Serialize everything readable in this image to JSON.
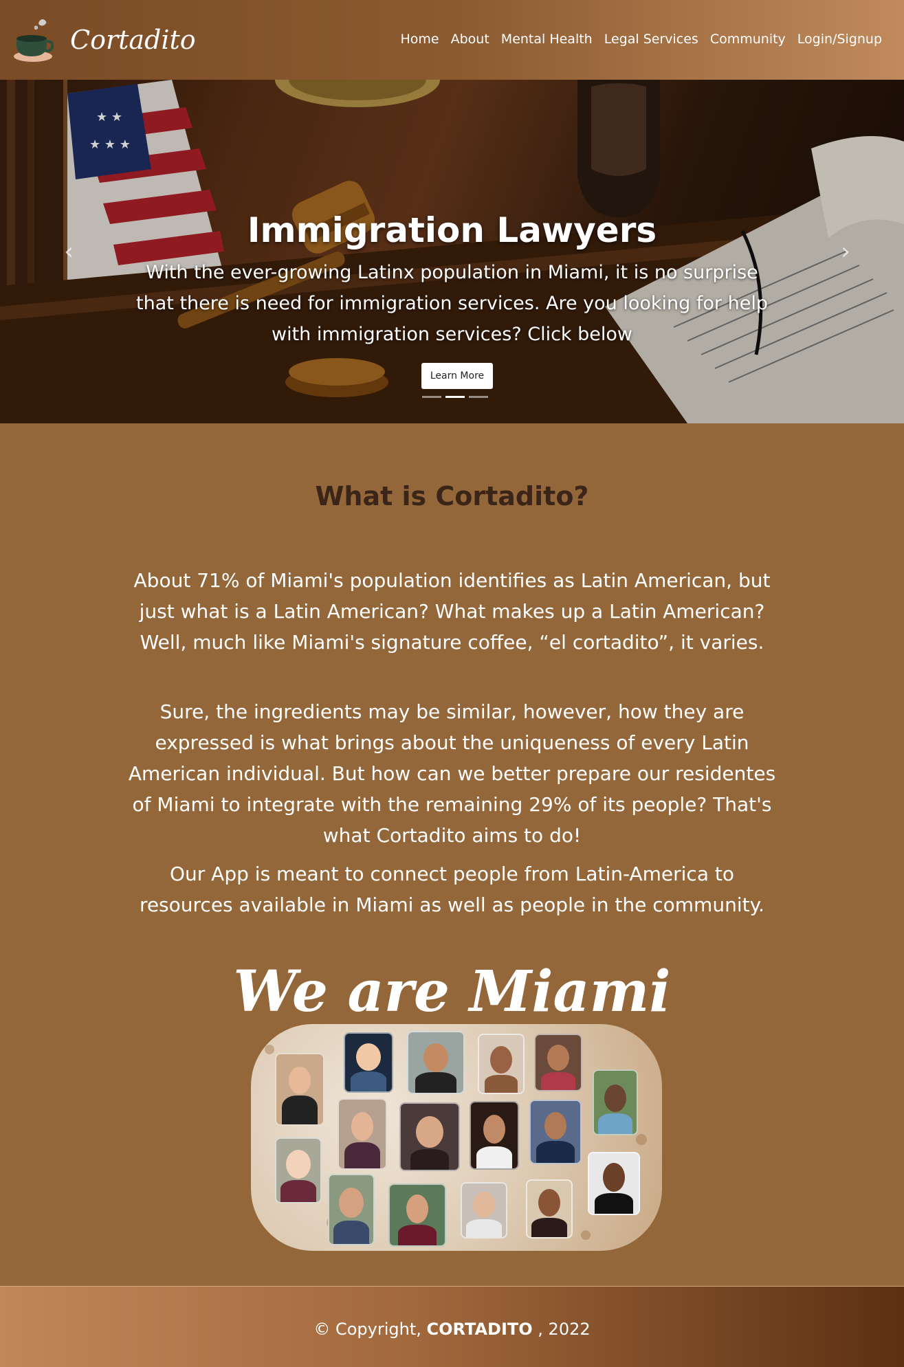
{
  "nav": {
    "brand": "Cortadito",
    "links": [
      "Home",
      "About",
      "Mental Health",
      "Legal Services",
      "Community",
      "Login/Signup"
    ]
  },
  "hero": {
    "title": "Immigration Lawyers",
    "text": "With the ever-growing Latinx population in Miami, it is no surprise that there is need for immigration services. Are you looking for help with immigration services? Click below",
    "button": "Learn More"
  },
  "about": {
    "title": "What is Cortadito?",
    "p1": "About 71% of Miami's population identifies as Latin American, but  just what is a Latin American? What makes up a Latin American? Well, much like Miami's signature coffee, “el cortadito”, it varies.",
    "p2": "Sure, the ingredients may be similar, however, how they are expressed is what brings about the uniqueness of every Latin American individual. But how can we better prepare our residentes of Miami to integrate with the remaining 29% of its people? That's what Cortadito aims to do!",
    "p3": "Our App is meant to connect people from Latin-America to resources available in Miami as well as people in the community."
  },
  "collage": {
    "title": "We are Miami"
  },
  "footer": {
    "prefix": "© Copyright,",
    "brand": "CORTADITO",
    "suffix": ", 2022"
  },
  "colors": {
    "background": "#94673a",
    "heading": "#3a2518"
  }
}
